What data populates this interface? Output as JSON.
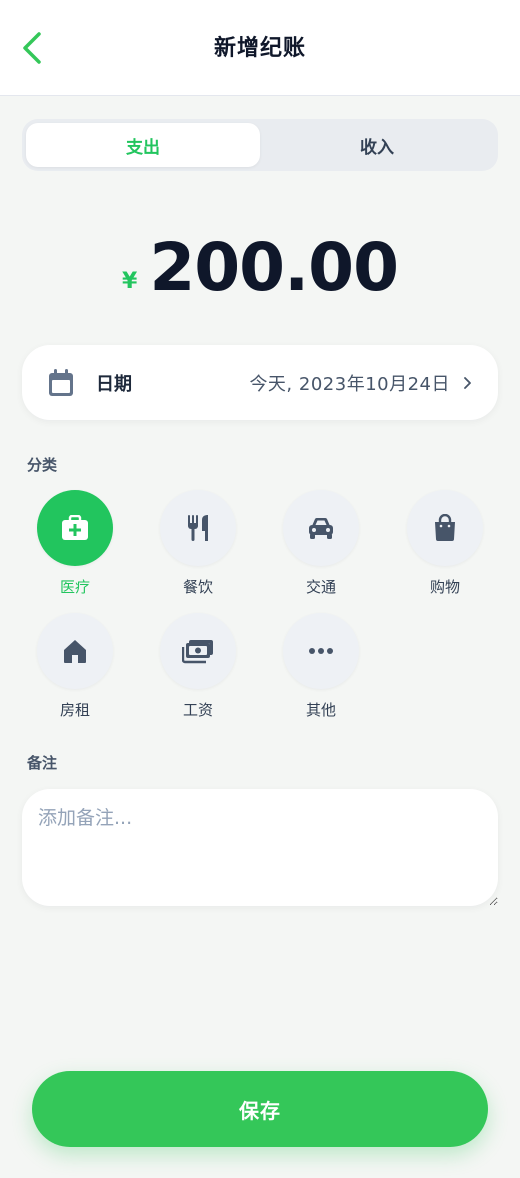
{
  "header": {
    "title": "新增纪账",
    "back_icon": "chevron-left-icon"
  },
  "segment": {
    "tabs": [
      {
        "label": "支出",
        "active": true
      },
      {
        "label": "收入",
        "active": false
      }
    ]
  },
  "amount": {
    "currency": "¥",
    "value": "200.00"
  },
  "date": {
    "label": "日期",
    "value": "今天, 2023年10月24日",
    "icon": "calendar-icon"
  },
  "categories": {
    "label": "分类",
    "items": [
      {
        "label": "医疗",
        "icon": "medical-kit-icon",
        "active": true
      },
      {
        "label": "餐饮",
        "icon": "utensils-icon",
        "active": false
      },
      {
        "label": "交通",
        "icon": "car-icon",
        "active": false
      },
      {
        "label": "购物",
        "icon": "shopping-bag-icon",
        "active": false
      },
      {
        "label": "房租",
        "icon": "house-icon",
        "active": false
      },
      {
        "label": "工资",
        "icon": "money-icon",
        "active": false
      },
      {
        "label": "其他",
        "icon": "more-icon",
        "active": false
      }
    ]
  },
  "note": {
    "label": "备注",
    "placeholder": "添加备注..."
  },
  "save": {
    "label": "保存"
  },
  "colors": {
    "accent": "#22c55e",
    "button": "#34c759",
    "text": "#0f172a",
    "icon": "#475569"
  }
}
